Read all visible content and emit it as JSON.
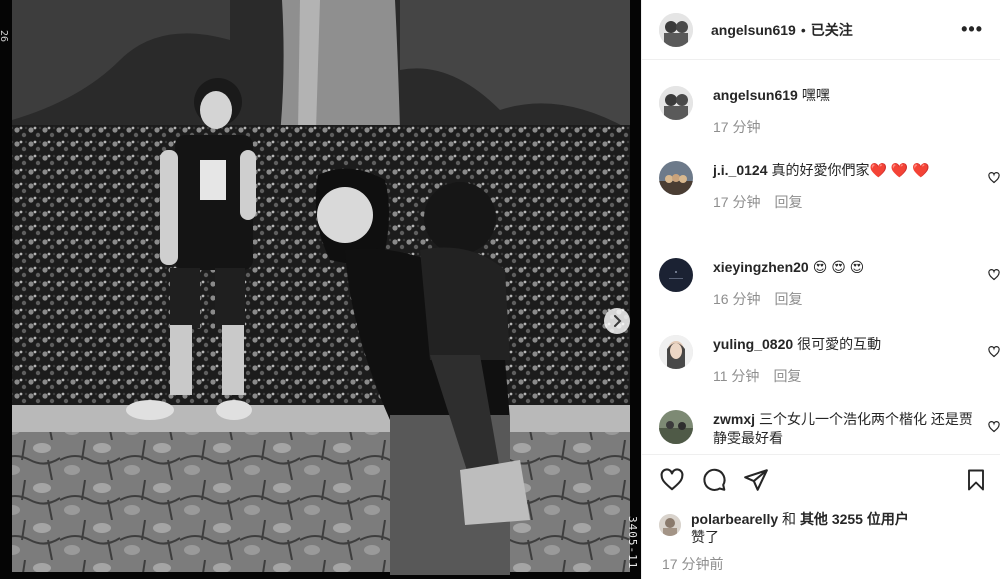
{
  "post": {
    "film_number": "3405-11",
    "film_mark_top": "26"
  },
  "header": {
    "username": "angelsun619",
    "separator": "•",
    "follow_status": "已关注",
    "more_glyph": "•••"
  },
  "comments": [
    {
      "username": "angelsun619",
      "text": "嘿嘿",
      "time": "17 分钟",
      "reply": "",
      "has_like": false
    },
    {
      "username": "j.i._0124",
      "text": "真的好愛你們家❤️ ❤️ ❤️",
      "time": "17 分钟",
      "reply": "回复",
      "has_like": true
    },
    {
      "username": "xieyingzhen20",
      "text": "😍 😍 😍",
      "time": "16 分钟",
      "reply": "回复",
      "has_like": true
    },
    {
      "username": "yuling_0820",
      "text": "很可愛的互動",
      "time": "11 分钟",
      "reply": "回复",
      "has_like": true
    },
    {
      "username": "zwmxj",
      "text": "三个女儿一个浩化两个楷化 还是贾静雯最好看",
      "time": "",
      "reply": "",
      "has_like": true
    }
  ],
  "likes": {
    "user": "polarbearelly",
    "and": "和",
    "others": "其他 3255 位用户",
    "suffix": "赞了"
  },
  "posted_time": "17 分钟前",
  "colors": {
    "muted": "#8e8e8e",
    "text": "#262626",
    "divider": "#efefef"
  }
}
